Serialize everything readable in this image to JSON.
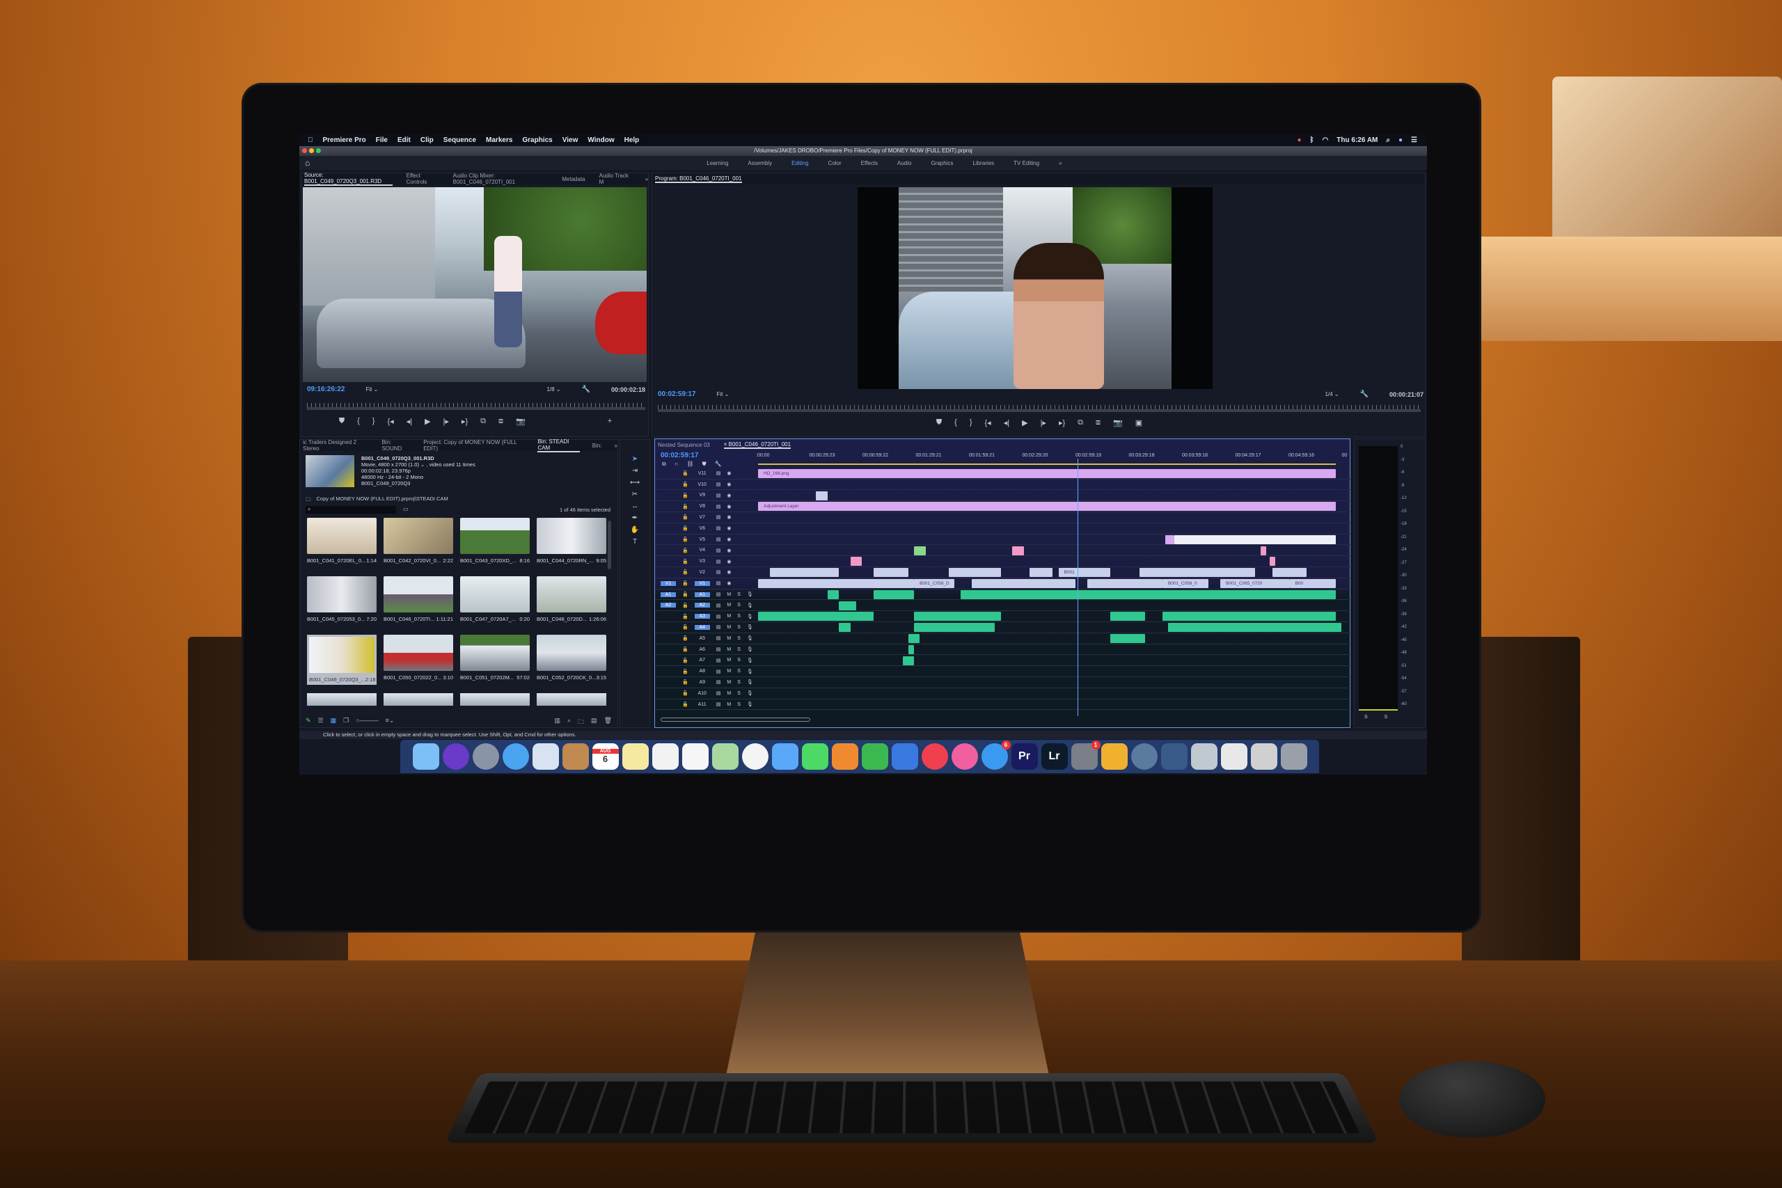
{
  "menubar": {
    "apple_icon": "apple-icon",
    "app": "Premiere Pro",
    "items": [
      "File",
      "Edit",
      "Clip",
      "Sequence",
      "Markers",
      "Graphics",
      "View",
      "Window",
      "Help"
    ],
    "clock": "Thu 6:26 AM",
    "status_icons": [
      "creative-cloud-icon",
      "bluetooth-icon",
      "wifi-icon",
      "search-icon",
      "siri-icon",
      "notification-center-icon"
    ]
  },
  "window": {
    "title": "/Volumes/JAKES DROBO/Premiere Pro Files/Copy of MONEY NOW (FULL EDIT).prproj"
  },
  "workspaces": {
    "items": [
      "Learning",
      "Assembly",
      "Editing",
      "Color",
      "Effects",
      "Audio",
      "Graphics",
      "Libraries",
      "TV Editing"
    ],
    "active": "Editing",
    "more": "»"
  },
  "source": {
    "tabs": [
      "Source: B001_C049_0720Q3_001.R3D",
      "Effect Controls",
      "Audio Clip Mixer: B001_C046_0720TI_001",
      "Metadata",
      "Audio Track M"
    ],
    "more": "»",
    "timecode": "09:16:26:22",
    "zoom": "Fit",
    "resolution": "1/8",
    "duration": "00:00:02:18"
  },
  "program": {
    "tab": "Program: B001_C046_0720TI_001",
    "timecode": "00:02:59:17",
    "zoom": "Fit",
    "resolution": "1/4",
    "duration": "00:00:21:07"
  },
  "transport_icons": [
    "marker-icon",
    "mark-in-icon",
    "mark-out-icon",
    "go-to-in-icon",
    "step-back-icon",
    "play-icon",
    "step-forward-icon",
    "go-to-out-icon",
    "insert-icon",
    "overwrite-icon",
    "export-frame-icon",
    "add-button-icon"
  ],
  "project": {
    "tabs": [
      "ic Trailers Designed 2 Stereo",
      "Bin: SOUND",
      "Project: Copy of MONEY NOW (FULL EDIT)",
      "Bin: STEADI CAM",
      "Bin:"
    ],
    "active_tab": "Bin: STEADI CAM",
    "more": "»",
    "preview": {
      "name": "B001_C049_0720Q3_001.R3D",
      "line1": "Movie, 4800 x 2700 (1.0) ⌄ , video used 11 times",
      "line2": "00:00:02:18, 23.976p",
      "line3": "48000 Hz - 24-bit - 2 Mono",
      "line4": "B001_C049_0720Q3"
    },
    "path": "Copy of MONEY NOW (FULL EDIT).prproj\\STEADI CAM",
    "search_placeholder": "",
    "selection": "1 of 46 items selected",
    "items": [
      {
        "name": "B001_C041_0720EL_0...",
        "dur": "1:14"
      },
      {
        "name": "B001_C042_0720VI_0...",
        "dur": "2:22"
      },
      {
        "name": "B001_C043_0720XD_...",
        "dur": "8:16"
      },
      {
        "name": "B001_C044_0720RN_...",
        "dur": "9:05"
      },
      {
        "name": "B001_C045_072053_0...",
        "dur": "7:20"
      },
      {
        "name": "B001_C046_0720TI...",
        "dur": "1:11:21"
      },
      {
        "name": "B001_C047_0720A7_...",
        "dur": "0:20"
      },
      {
        "name": "B001_C048_0720D...",
        "dur": "1:26:06"
      },
      {
        "name": "B001_C049_0720Q3_...",
        "dur": "2:18"
      },
      {
        "name": "B001_C050_072022_0...",
        "dur": "3:10"
      },
      {
        "name": "B001_C051_07202M...",
        "dur": "57:02"
      },
      {
        "name": "B001_C052_0720CK_0...",
        "dur": "3:15"
      }
    ]
  },
  "timeline": {
    "tabs": [
      "Nested Sequence 03",
      "B001_C046_0720TI_001"
    ],
    "timecode": "00:02:59:17",
    "ruler": [
      ":00:00",
      "00:00:29:23",
      "00:00:59:22",
      "00:01:29:21",
      "00:01:59:21",
      "00:02:29:20",
      "00:02:59:19",
      "00:03:29:18",
      "00:03:59:18",
      "00:04:29:17",
      "00:04:59:16",
      "00"
    ],
    "video_tracks": [
      "V11",
      "V10",
      "V9",
      "V8",
      "V7",
      "V6",
      "V5",
      "V4",
      "V3",
      "V2",
      "V1"
    ],
    "audio_tracks": [
      "A1",
      "A2",
      "A3",
      "A4",
      "A5",
      "A6",
      "A7",
      "A8",
      "A9",
      "A10",
      "A11"
    ],
    "source_patch": {
      "video": "V1",
      "audio": [
        "A1",
        "A2"
      ]
    },
    "mute": "M",
    "solo": "S",
    "clips": {
      "v11": "HD_166.png",
      "v8": "Adjustment Layer",
      "v1a": "B001_C058_D",
      "v1b": "B001_C058_0",
      "v1c": "B001_C065_0720",
      "v1d": "B00",
      "v2": "B001"
    }
  },
  "meter": {
    "scale": [
      "0",
      "-3",
      "-6",
      "-9",
      "-12",
      "-15",
      "-18",
      "-21",
      "-24",
      "-27",
      "-30",
      "-33",
      "-36",
      "-39",
      "-42",
      "-45",
      "-48",
      "-51",
      "-54",
      "-57",
      "-60"
    ],
    "solo": [
      "S",
      "S"
    ]
  },
  "status": "Click to select, or click in empty space and drag to marquee select. Use Shift, Opt, and Cmd for other options.",
  "dock": [
    {
      "icon": "finder-icon",
      "color": "#7cc0f5"
    },
    {
      "icon": "siri-icon",
      "color": "#6a3ac8"
    },
    {
      "icon": "launchpad-icon",
      "color": "#8a94a6"
    },
    {
      "icon": "safari-icon",
      "color": "#4aa4f0"
    },
    {
      "icon": "preview-icon",
      "color": "#d8e2f0"
    },
    {
      "icon": "contacts-icon",
      "color": "#c08a50"
    },
    {
      "icon": "calendar-icon",
      "color": "#ffffff",
      "month": "AUG",
      "day": "6"
    },
    {
      "icon": "notes-icon",
      "color": "#f7e8a0"
    },
    {
      "icon": "textedit-icon",
      "color": "#f2f2f2"
    },
    {
      "icon": "reminders-icon",
      "color": "#f6f6f6"
    },
    {
      "icon": "maps-icon",
      "color": "#a8d8a0"
    },
    {
      "icon": "photos-icon",
      "color": "#f4f4f4"
    },
    {
      "icon": "messages-icon",
      "color": "#5aa8f8"
    },
    {
      "icon": "facetime-icon",
      "color": "#4cd964"
    },
    {
      "icon": "pages-icon",
      "color": "#f08a30"
    },
    {
      "icon": "numbers-icon",
      "color": "#3cb850"
    },
    {
      "icon": "keynote-icon",
      "color": "#3a7ae0"
    },
    {
      "icon": "news-icon",
      "color": "#f04050"
    },
    {
      "icon": "itunes-icon",
      "color": "#f060a0"
    },
    {
      "icon": "app-store-icon",
      "color": "#3a9af0",
      "badge": "6"
    },
    {
      "icon": "premiere-pro-icon",
      "color": "#1a1a60",
      "label": "Pr"
    },
    {
      "icon": "lightroom-icon",
      "color": "#0c1a2a",
      "label": "Lr"
    },
    {
      "icon": "system-preferences-icon",
      "color": "#7a7f88",
      "badge": "1"
    },
    {
      "icon": "music-folder-icon",
      "color": "#f0b030"
    },
    {
      "icon": "quicktime-icon",
      "color": "#5a7aa0"
    },
    {
      "icon": "prompt-icon",
      "color": "#3a5a8a"
    },
    {
      "icon": "image-capture-icon",
      "color": "#c0c8d0"
    },
    {
      "icon": "document-icon",
      "color": "#e8e8e8"
    },
    {
      "icon": "downloads-stack-icon",
      "color": "#d0d0d0"
    },
    {
      "icon": "trash-icon",
      "color": "#9aa0a8"
    }
  ]
}
